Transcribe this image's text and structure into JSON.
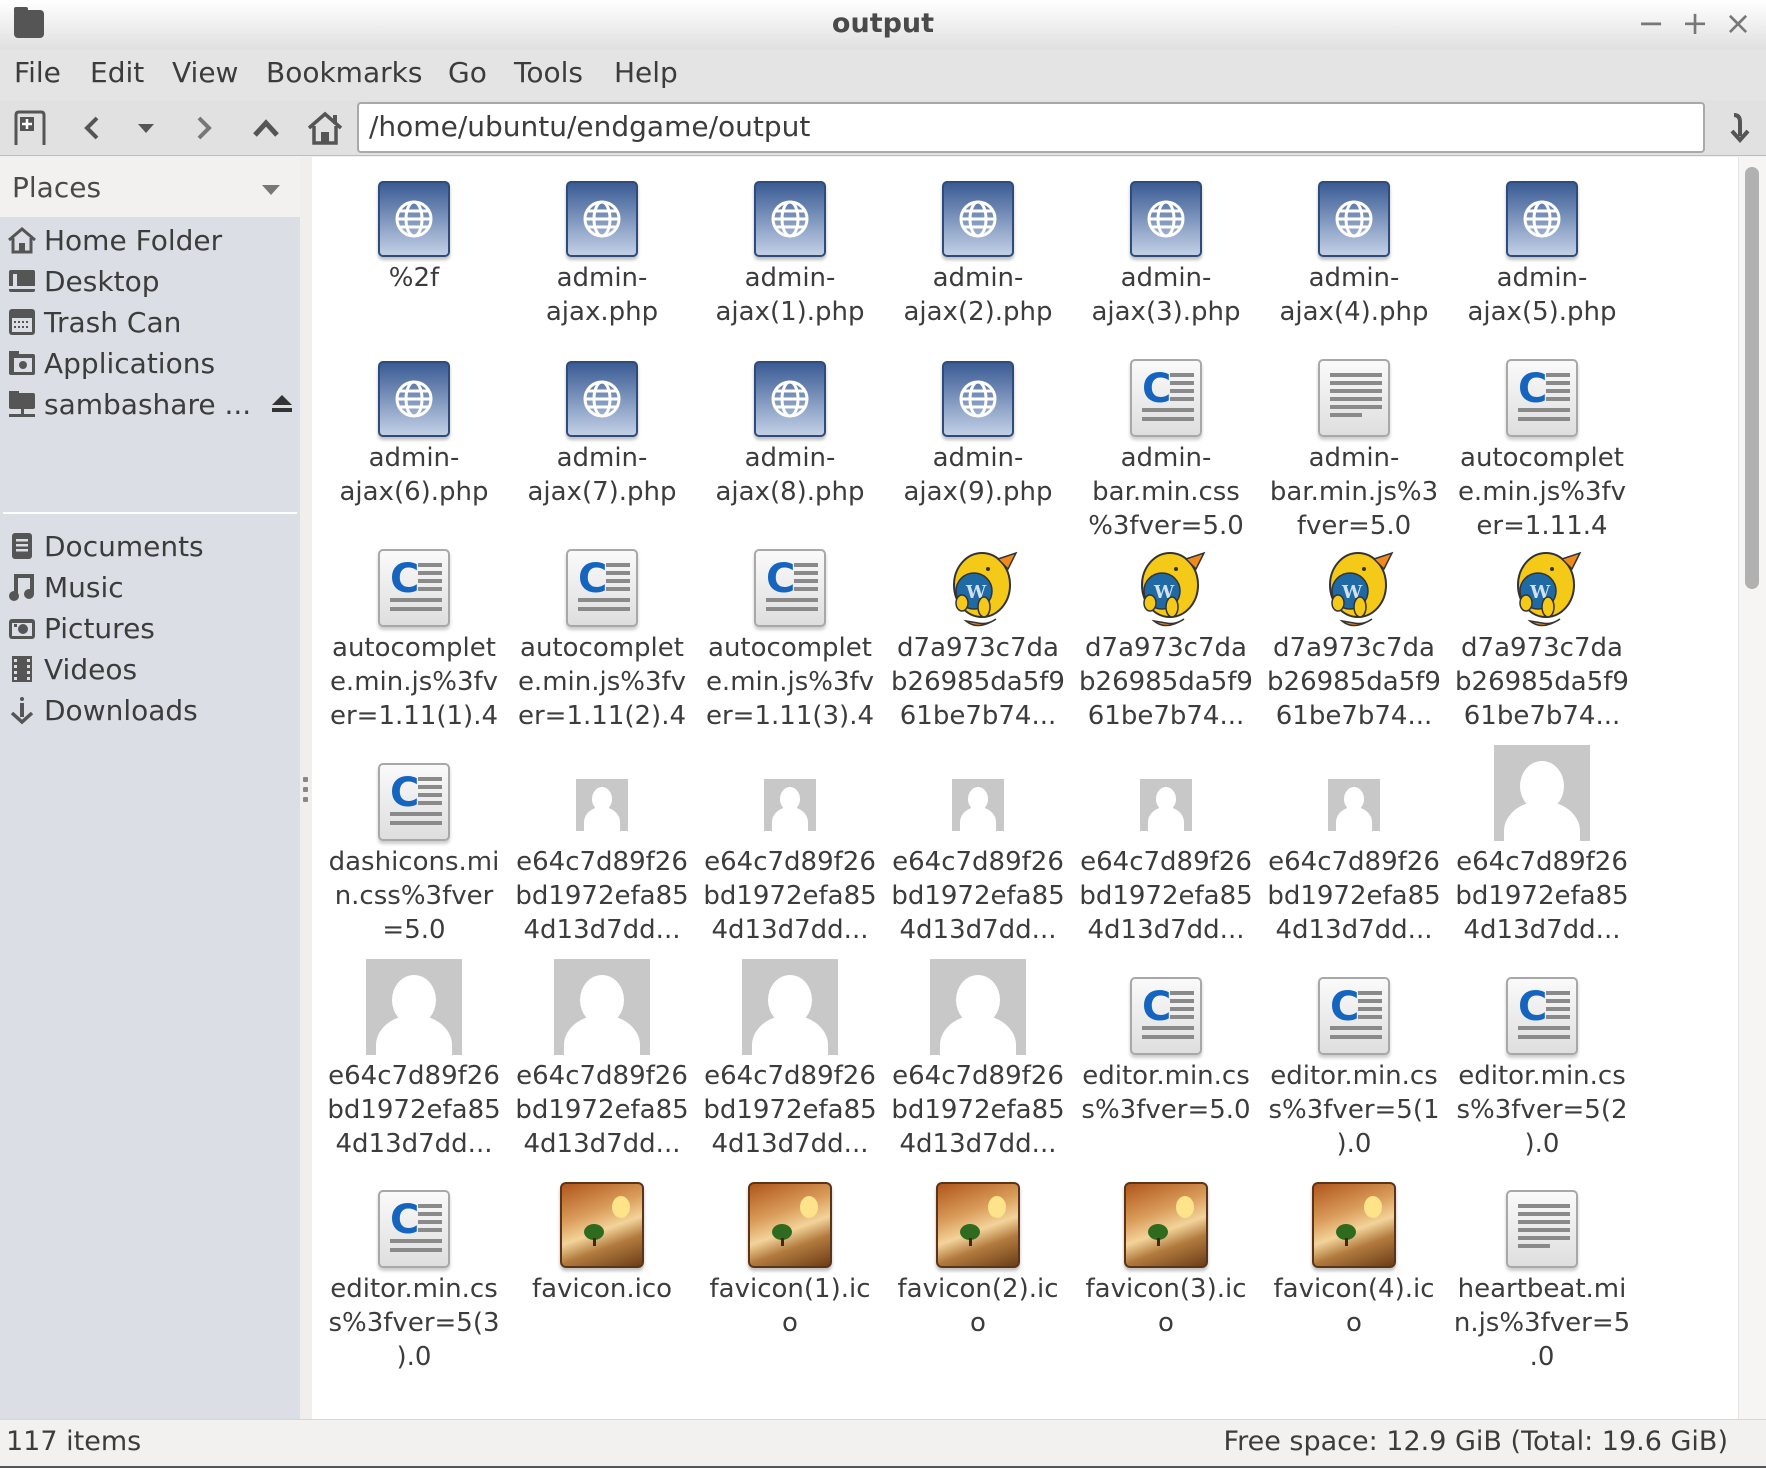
{
  "window": {
    "title": "output",
    "controls": {
      "minimize": "−",
      "maximize": "+",
      "close": "×"
    }
  },
  "menu": [
    "File",
    "Edit",
    "View",
    "Bookmarks",
    "Go",
    "Tools",
    "Help"
  ],
  "toolbar": {
    "new_tab": "new-tab-icon",
    "back": "back-icon",
    "history": "history-dropdown-icon",
    "forward": "forward-icon",
    "up": "up-icon",
    "home": "home-icon",
    "location": "/home/ubuntu/endgame/output",
    "go": "go-icon"
  },
  "sidebar": {
    "header": "Places",
    "places": [
      {
        "label": "Home Folder",
        "icon": "home-icon"
      },
      {
        "label": "Desktop",
        "icon": "desktop-icon"
      },
      {
        "label": "Trash Can",
        "icon": "trash-icon"
      },
      {
        "label": "Applications",
        "icon": "applications-icon"
      },
      {
        "label": "sambashare ...",
        "icon": "network-share-icon",
        "eject": true
      }
    ],
    "bookmarks": [
      {
        "label": "Documents",
        "icon": "documents-icon"
      },
      {
        "label": "Music",
        "icon": "music-icon"
      },
      {
        "label": "Pictures",
        "icon": "pictures-icon"
      },
      {
        "label": "Videos",
        "icon": "videos-icon"
      },
      {
        "label": "Downloads",
        "icon": "downloads-icon"
      }
    ]
  },
  "files": [
    {
      "name": "%2f",
      "lines": [
        "%2f"
      ],
      "type": "web"
    },
    {
      "name": "admin-ajax.php",
      "lines": [
        "admin-",
        "ajax.php"
      ],
      "type": "web"
    },
    {
      "name": "admin-ajax(1).php",
      "lines": [
        "admin-",
        "ajax(1).php"
      ],
      "type": "web"
    },
    {
      "name": "admin-ajax(2).php",
      "lines": [
        "admin-",
        "ajax(2).php"
      ],
      "type": "web"
    },
    {
      "name": "admin-ajax(3).php",
      "lines": [
        "admin-",
        "ajax(3).php"
      ],
      "type": "web"
    },
    {
      "name": "admin-ajax(4).php",
      "lines": [
        "admin-",
        "ajax(4).php"
      ],
      "type": "web"
    },
    {
      "name": "admin-ajax(5).php",
      "lines": [
        "admin-",
        "ajax(5).php"
      ],
      "type": "web"
    },
    {
      "name": "admin-ajax(6).php",
      "lines": [
        "admin-",
        "ajax(6).php"
      ],
      "type": "web"
    },
    {
      "name": "admin-ajax(7).php",
      "lines": [
        "admin-",
        "ajax(7).php"
      ],
      "type": "web"
    },
    {
      "name": "admin-ajax(8).php",
      "lines": [
        "admin-",
        "ajax(8).php"
      ],
      "type": "web"
    },
    {
      "name": "admin-ajax(9).php",
      "lines": [
        "admin-",
        "ajax(9).php"
      ],
      "type": "web"
    },
    {
      "name": "admin-bar.min.css%3fver=5.0",
      "lines": [
        "admin-",
        "bar.min.css",
        "%3fver=5.0"
      ],
      "type": "css"
    },
    {
      "name": "admin-bar.min.js%3fver=5.0",
      "lines": [
        "admin-",
        "bar.min.js%3",
        "fver=5.0"
      ],
      "type": "text"
    },
    {
      "name": "autocomplete.min.js%3fver=1.11.4",
      "lines": [
        "autocomplet",
        "e.min.js%3fv",
        "er=1.11.4"
      ],
      "type": "css"
    },
    {
      "name": "autocomplete.min.js%3fver=1.11(1).4",
      "lines": [
        "autocomplet",
        "e.min.js%3fv",
        "er=1.11(1).4"
      ],
      "type": "css"
    },
    {
      "name": "autocomplete.min.js%3fver=1.11(2).4",
      "lines": [
        "autocomplet",
        "e.min.js%3fv",
        "er=1.11(2).4"
      ],
      "type": "css"
    },
    {
      "name": "autocomplete.min.js%3fver=1.11(3).4",
      "lines": [
        "autocomplet",
        "e.min.js%3fv",
        "er=1.11(3).4"
      ],
      "type": "css"
    },
    {
      "name": "d7a973c7dab26985da5f961be7b74...",
      "lines": [
        "d7a973c7da",
        "b26985da5f9",
        "61be7b74..."
      ],
      "type": "wapuu"
    },
    {
      "name": "d7a973c7dab26985da5f961be7b74...",
      "lines": [
        "d7a973c7da",
        "b26985da5f9",
        "61be7b74..."
      ],
      "type": "wapuu"
    },
    {
      "name": "d7a973c7dab26985da5f961be7b74...",
      "lines": [
        "d7a973c7da",
        "b26985da5f9",
        "61be7b74..."
      ],
      "type": "wapuu"
    },
    {
      "name": "d7a973c7dab26985da5f961be7b74...",
      "lines": [
        "d7a973c7da",
        "b26985da5f9",
        "61be7b74..."
      ],
      "type": "wapuu"
    },
    {
      "name": "dashicons.min.css%3fver=5.0",
      "lines": [
        "dashicons.mi",
        "n.css%3fver",
        "=5.0"
      ],
      "type": "css"
    },
    {
      "name": "e64c7d89f26bd1972efa854d13d7dd...",
      "lines": [
        "e64c7d89f26",
        "bd1972efa85",
        "4d13d7dd..."
      ],
      "type": "avatar-small"
    },
    {
      "name": "e64c7d89f26bd1972efa854d13d7dd...",
      "lines": [
        "e64c7d89f26",
        "bd1972efa85",
        "4d13d7dd..."
      ],
      "type": "avatar-small"
    },
    {
      "name": "e64c7d89f26bd1972efa854d13d7dd...",
      "lines": [
        "e64c7d89f26",
        "bd1972efa85",
        "4d13d7dd..."
      ],
      "type": "avatar-small"
    },
    {
      "name": "e64c7d89f26bd1972efa854d13d7dd...",
      "lines": [
        "e64c7d89f26",
        "bd1972efa85",
        "4d13d7dd..."
      ],
      "type": "avatar-small"
    },
    {
      "name": "e64c7d89f26bd1972efa854d13d7dd...",
      "lines": [
        "e64c7d89f26",
        "bd1972efa85",
        "4d13d7dd..."
      ],
      "type": "avatar-small"
    },
    {
      "name": "e64c7d89f26bd1972efa854d13d7dd...",
      "lines": [
        "e64c7d89f26",
        "bd1972efa85",
        "4d13d7dd..."
      ],
      "type": "avatar-large"
    },
    {
      "name": "e64c7d89f26bd1972efa854d13d7dd...",
      "lines": [
        "e64c7d89f26",
        "bd1972efa85",
        "4d13d7dd..."
      ],
      "type": "avatar-large"
    },
    {
      "name": "e64c7d89f26bd1972efa854d13d7dd...",
      "lines": [
        "e64c7d89f26",
        "bd1972efa85",
        "4d13d7dd..."
      ],
      "type": "avatar-large"
    },
    {
      "name": "e64c7d89f26bd1972efa854d13d7dd...",
      "lines": [
        "e64c7d89f26",
        "bd1972efa85",
        "4d13d7dd..."
      ],
      "type": "avatar-large"
    },
    {
      "name": "e64c7d89f26bd1972efa854d13d7dd...",
      "lines": [
        "e64c7d89f26",
        "bd1972efa85",
        "4d13d7dd..."
      ],
      "type": "avatar-large"
    },
    {
      "name": "editor.min.css%3fver=5.0",
      "lines": [
        "editor.min.cs",
        "s%3fver=5.0"
      ],
      "type": "css"
    },
    {
      "name": "editor.min.css%3fver=5(1).0",
      "lines": [
        "editor.min.cs",
        "s%3fver=5(1",
        ").0"
      ],
      "type": "css"
    },
    {
      "name": "editor.min.css%3fver=5(2).0",
      "lines": [
        "editor.min.cs",
        "s%3fver=5(2",
        ").0"
      ],
      "type": "css"
    },
    {
      "name": "editor.min.css%3fver=5(3).0",
      "lines": [
        "editor.min.cs",
        "s%3fver=5(3",
        ").0"
      ],
      "type": "css"
    },
    {
      "name": "favicon.ico",
      "lines": [
        "favicon.ico"
      ],
      "type": "image"
    },
    {
      "name": "favicon(1).ico",
      "lines": [
        "favicon(1).ic",
        "o"
      ],
      "type": "image"
    },
    {
      "name": "favicon(2).ico",
      "lines": [
        "favicon(2).ic",
        "o"
      ],
      "type": "image"
    },
    {
      "name": "favicon(3).ico",
      "lines": [
        "favicon(3).ic",
        "o"
      ],
      "type": "image"
    },
    {
      "name": "favicon(4).ico",
      "lines": [
        "favicon(4).ic",
        "o"
      ],
      "type": "image"
    },
    {
      "name": "heartbeat.min.js%3fver=5.0",
      "lines": [
        "heartbeat.mi",
        "n.js%3fver=5",
        ".0"
      ],
      "type": "text"
    }
  ],
  "scrollbar": {
    "position_fraction": 0.0,
    "visible_fraction": 0.34
  },
  "status": {
    "item_count": "117 items",
    "free_space": "Free space: 12.9 GiB (Total: 19.6 GiB)"
  },
  "colors": {
    "sidebar_bg": "#dbdfe5",
    "web_icon": "#3a5b94",
    "css_icon_letter": "#1565c0"
  }
}
